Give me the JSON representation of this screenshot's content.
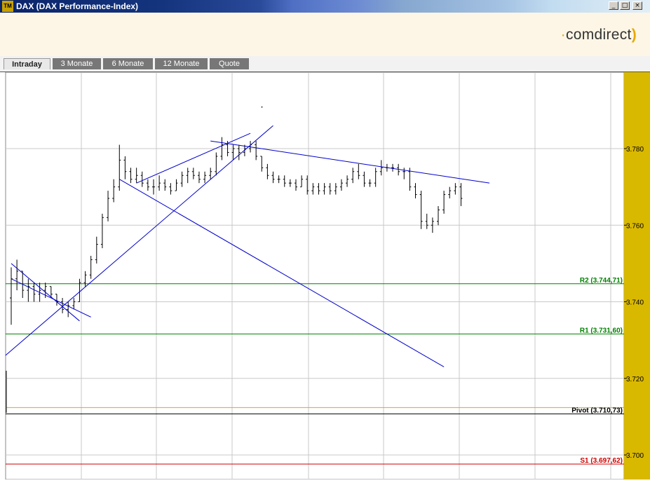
{
  "window": {
    "title": "DAX (DAX Performance-Index)",
    "icon_text": "TM",
    "minimize_label": "_",
    "maximize_label": "□",
    "close_label": "×"
  },
  "header": {
    "logo_text": "comdirect",
    "brand_color": "#e8a800"
  },
  "tabs": [
    {
      "label": "Intraday",
      "active": true
    },
    {
      "label": "3 Monate",
      "active": false
    },
    {
      "label": "6 Monate",
      "active": false
    },
    {
      "label": "12 Monate",
      "active": false
    },
    {
      "label": "Quote",
      "active": false
    }
  ],
  "chart_data": {
    "type": "ohlc",
    "ylim": [
      3698,
      3801
    ],
    "y_ticks": [
      {
        "value": 3780,
        "label": "3.780"
      },
      {
        "value": 3760,
        "label": "3.760"
      },
      {
        "value": 3740,
        "label": "3.740"
      },
      {
        "value": 3720,
        "label": "3.720"
      },
      {
        "value": 3700,
        "label": "3.700"
      }
    ],
    "levels": [
      {
        "name": "R2",
        "value": 3744.71,
        "label": "R2 (3.744,71)",
        "color": "#008000"
      },
      {
        "name": "R1",
        "value": 3731.6,
        "label": "R1 (3.731,60)",
        "color": "#008000"
      },
      {
        "name": "Pivot",
        "value": 3710.73,
        "label": "Pivot (3.710,73)",
        "color": "#000000"
      },
      {
        "name": "S1",
        "value": 3697.62,
        "label": "S1 (3.697,62)",
        "color": "#cc0000"
      }
    ],
    "pivot_band_color": "#d4b000",
    "axis_strip_color": "#d9b800",
    "trendline_color": "#0000cc",
    "bar_count": 100,
    "bars": [
      [
        3741,
        3749,
        3734,
        3746
      ],
      [
        3746,
        3751,
        3743,
        3748
      ],
      [
        3748,
        3748,
        3741,
        3743
      ],
      [
        3743,
        3746,
        3740,
        3744
      ],
      [
        3744,
        3745,
        3740,
        3742
      ],
      [
        3742,
        3745,
        3740,
        3743
      ],
      [
        3743,
        3745,
        3741,
        3744
      ],
      [
        3744,
        3744,
        3741,
        3742
      ],
      [
        3742,
        3742,
        3739,
        3740
      ],
      [
        3740,
        3741,
        3737,
        3738
      ],
      [
        3738,
        3740,
        3736,
        3739
      ],
      [
        3739,
        3741,
        3738,
        3740
      ],
      [
        3740,
        3746,
        3740,
        3745
      ],
      [
        3745,
        3748,
        3744,
        3747
      ],
      [
        3747,
        3752,
        3746,
        3751
      ],
      [
        3751,
        3757,
        3750,
        3755
      ],
      [
        3755,
        3763,
        3754,
        3762
      ],
      [
        3762,
        3769,
        3761,
        3767
      ],
      [
        3767,
        3772,
        3766,
        3770
      ],
      [
        3770,
        3781,
        3769,
        3777
      ],
      [
        3777,
        3778,
        3772,
        3774
      ],
      [
        3774,
        3775,
        3771,
        3772
      ],
      [
        3772,
        3775,
        3771,
        3773
      ],
      [
        3773,
        3774,
        3770,
        3771
      ],
      [
        3771,
        3772,
        3769,
        3770
      ],
      [
        3770,
        3772,
        3768,
        3770
      ],
      [
        3770,
        3773,
        3769,
        3771
      ],
      [
        3771,
        3772,
        3769,
        3770
      ],
      [
        3770,
        3771,
        3768,
        3769
      ],
      [
        3769,
        3772,
        3769,
        3771
      ],
      [
        3771,
        3774,
        3770,
        3773
      ],
      [
        3773,
        3775,
        3771,
        3774
      ],
      [
        3774,
        3775,
        3772,
        3773
      ],
      [
        3773,
        3774,
        3771,
        3772
      ],
      [
        3772,
        3774,
        3771,
        3773
      ],
      [
        3773,
        3775,
        3772,
        3774
      ],
      [
        3774,
        3779,
        3773,
        3778
      ],
      [
        3778,
        3783,
        3777,
        3781
      ],
      [
        3781,
        3782,
        3778,
        3779
      ],
      [
        3779,
        3781,
        3777,
        3780
      ],
      [
        3780,
        3781,
        3777,
        3779
      ],
      [
        3779,
        3781,
        3778,
        3780
      ],
      [
        3780,
        3782,
        3779,
        3781
      ],
      [
        3781,
        3782,
        3777,
        3778
      ],
      [
        3778,
        3778,
        3774,
        3775
      ],
      [
        3775,
        3776,
        3772,
        3773
      ],
      [
        3773,
        3774,
        3771,
        3772
      ],
      [
        3772,
        3773,
        3771,
        3772
      ],
      [
        3772,
        3773,
        3770,
        3771
      ],
      [
        3771,
        3772,
        3770,
        3771
      ],
      [
        3771,
        3772,
        3769,
        3770
      ],
      [
        3770,
        3773,
        3770,
        3772
      ],
      [
        3772,
        3773,
        3768,
        3769
      ],
      [
        3769,
        3771,
        3768,
        3770
      ],
      [
        3770,
        3771,
        3768,
        3769
      ],
      [
        3769,
        3771,
        3768,
        3770
      ],
      [
        3770,
        3771,
        3768,
        3769
      ],
      [
        3769,
        3771,
        3768,
        3770
      ],
      [
        3770,
        3772,
        3769,
        3771
      ],
      [
        3771,
        3773,
        3770,
        3772
      ],
      [
        3772,
        3775,
        3771,
        3774
      ],
      [
        3774,
        3776,
        3772,
        3773
      ],
      [
        3773,
        3774,
        3770,
        3771
      ],
      [
        3771,
        3772,
        3770,
        3771
      ],
      [
        3771,
        3775,
        3770,
        3774
      ],
      [
        3774,
        3777,
        3773,
        3775
      ],
      [
        3775,
        3776,
        3774,
        3775
      ],
      [
        3775,
        3776,
        3774,
        3775
      ],
      [
        3775,
        3776,
        3773,
        3774
      ],
      [
        3774,
        3775,
        3772,
        3774
      ],
      [
        3774,
        3775,
        3769,
        3770
      ],
      [
        3770,
        3771,
        3767,
        3768
      ],
      [
        3768,
        3769,
        3759,
        3761
      ],
      [
        3761,
        3763,
        3759,
        3760
      ],
      [
        3760,
        3762,
        3758,
        3761
      ],
      [
        3761,
        3765,
        3760,
        3764
      ],
      [
        3764,
        3769,
        3763,
        3768
      ],
      [
        3768,
        3770,
        3767,
        3769
      ],
      [
        3769,
        3771,
        3768,
        3770
      ],
      [
        3770,
        3771,
        3765,
        3767
      ]
    ],
    "trendlines": [
      {
        "from": [
          0,
          3750
        ],
        "to": [
          12,
          3735
        ]
      },
      {
        "from": [
          0,
          3746
        ],
        "to": [
          14,
          3736
        ]
      },
      {
        "from": [
          -1,
          3726
        ],
        "to": [
          46,
          3786
        ]
      },
      {
        "from": [
          19,
          3772
        ],
        "to": [
          76,
          3723
        ]
      },
      {
        "from": [
          22,
          3771
        ],
        "to": [
          42,
          3784
        ]
      },
      {
        "from": [
          35,
          3782
        ],
        "to": [
          84,
          3771
        ]
      }
    ],
    "marker_point": [
      44,
      3791
    ]
  }
}
